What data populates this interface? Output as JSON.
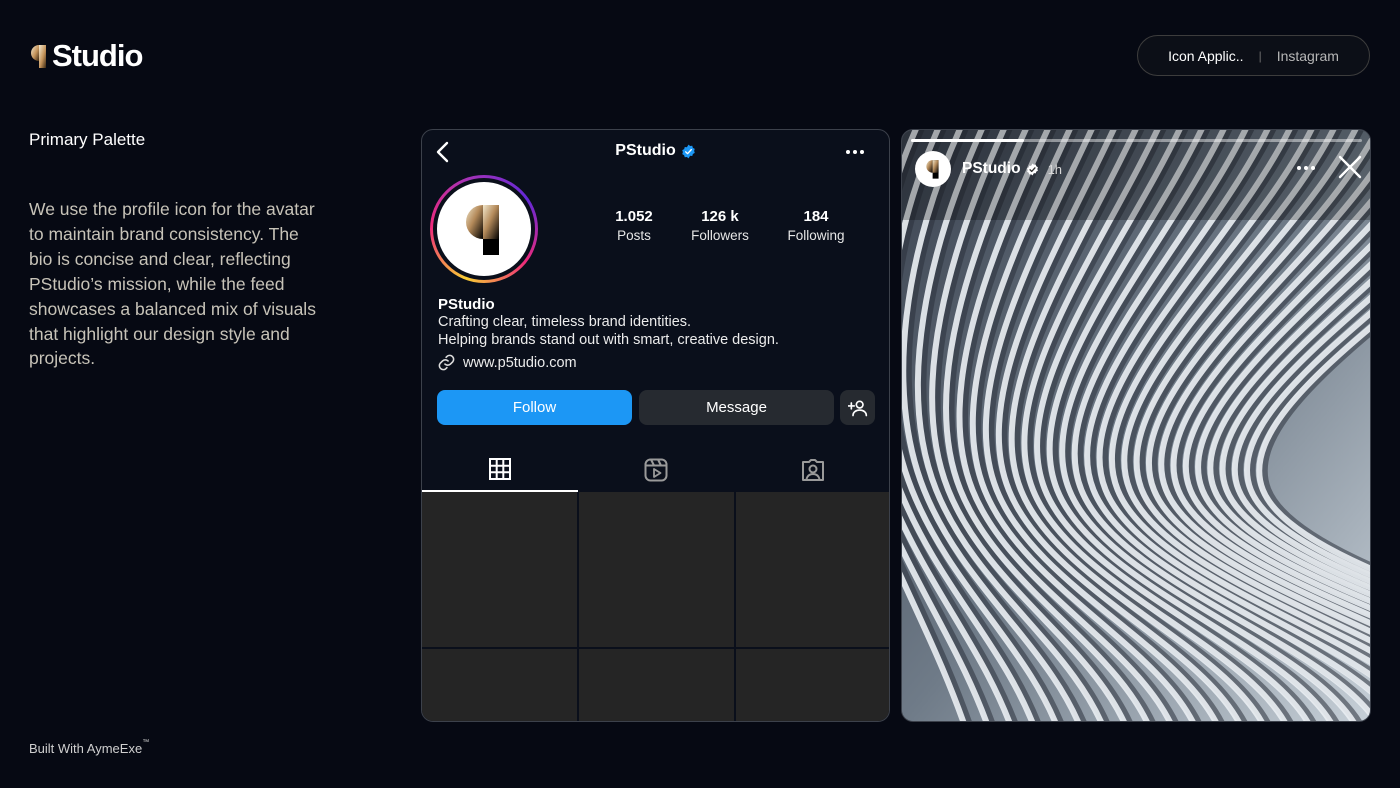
{
  "brand": {
    "logo_text": "Studio",
    "accent_gradient": [
      "#f2e6c9",
      "#c4935a",
      "#2b1d0e"
    ]
  },
  "header": {
    "pill_primary": "Icon Applic..",
    "pill_separator": "|",
    "pill_secondary": "Instagram"
  },
  "left": {
    "section_title": "Primary Palette",
    "description": "We use the profile icon for the avatar to maintain brand consistency. The bio is concise and clear, reflecting PStudio’s mission, while the feed showcases a balanced mix of visuals that highlight our design style and projects.",
    "credit": "Built With AymeExe",
    "credit_mark": "™"
  },
  "profile": {
    "username": "PStudio",
    "verified_color": "#1c97f5",
    "stats": [
      {
        "value": "1.052",
        "label": "Posts"
      },
      {
        "value": "126 k",
        "label": "Followers"
      },
      {
        "value": "184",
        "label": "Following"
      }
    ],
    "name": "PStudio",
    "bio_line1": "Crafting clear, timeless brand identities.",
    "bio_line2": "Helping brands stand out with smart, creative design.",
    "website": "www.p5tudio.com",
    "follow_label": "Follow",
    "message_label": "Message",
    "follow_color": "#1c97f5",
    "tabs": [
      "grid-icon",
      "reels-icon",
      "tagged-icon"
    ],
    "active_tab": 0
  },
  "story": {
    "username": "PStudio",
    "time": "1h",
    "progress": 0.25
  }
}
